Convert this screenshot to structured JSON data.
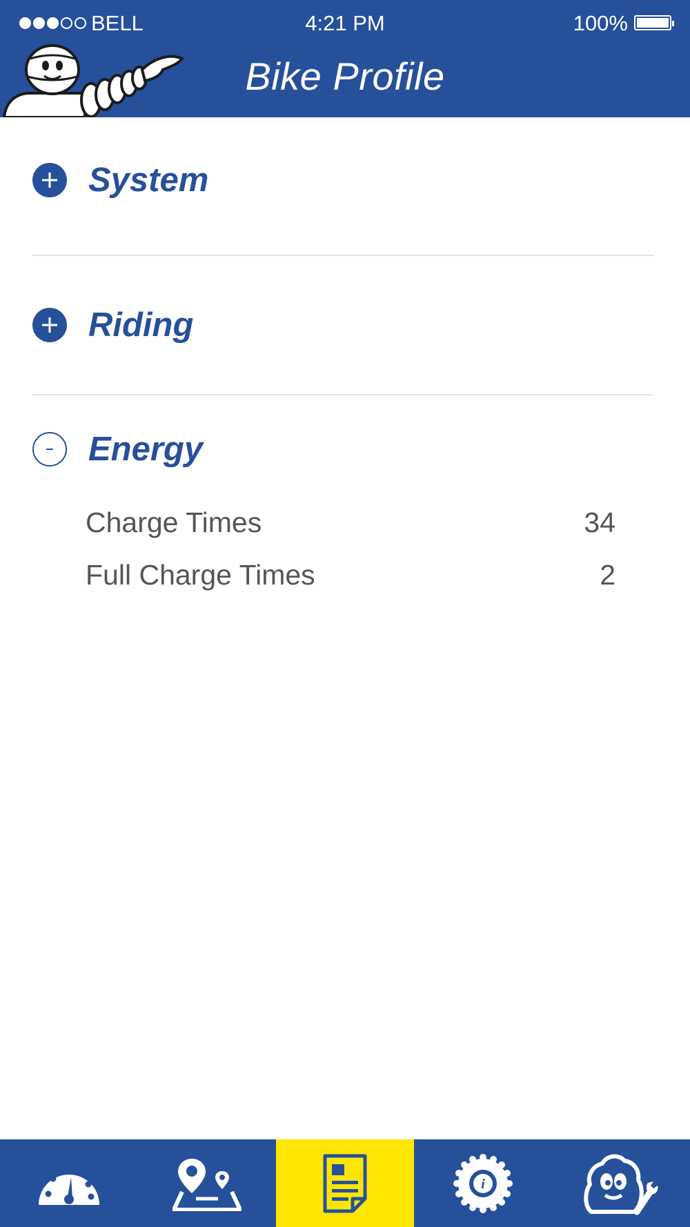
{
  "status_bar": {
    "carrier": "BELL",
    "time": "4:21 PM",
    "battery": "100%",
    "signal_bars_filled": 3,
    "signal_bars_total": 5
  },
  "header": {
    "title": "Bike Profile",
    "logo_icon": "mascot-icon"
  },
  "sections": [
    {
      "title": "System",
      "expanded": false
    },
    {
      "title": "Riding",
      "expanded": false
    },
    {
      "title": "Energy",
      "expanded": true,
      "rows": [
        {
          "label": "Charge Times",
          "value": "34"
        },
        {
          "label": "Full Charge Times",
          "value": "2"
        }
      ]
    }
  ],
  "nav": {
    "items": [
      {
        "icon": "speedometer-icon"
      },
      {
        "icon": "map-route-icon"
      },
      {
        "icon": "document-icon",
        "active": true
      },
      {
        "icon": "tire-info-icon"
      },
      {
        "icon": "mascot-tools-icon"
      }
    ]
  },
  "colors": {
    "primary": "#27509b",
    "active_tab": "#ffe600",
    "text_gray": "#555555",
    "divider": "#e2e2e2"
  }
}
